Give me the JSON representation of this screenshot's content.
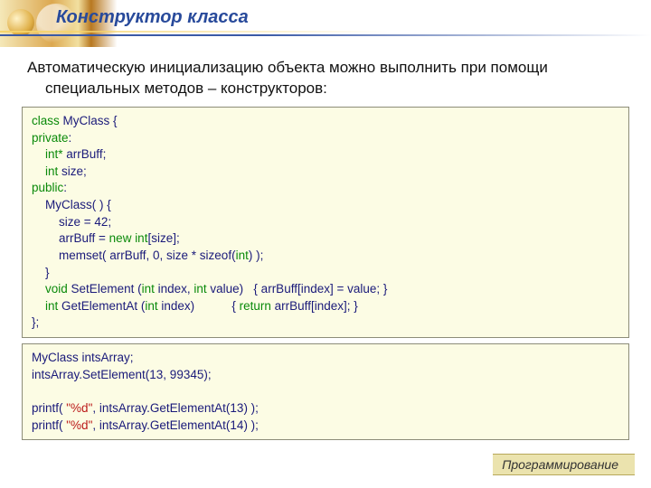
{
  "title": "Конструктор класса",
  "paragraph": "Автоматическую инициализацию объекта можно выполнить при помощи специальных методов – конструкторов:",
  "footer": "Программирование",
  "code1_lines": [
    [
      [
        "g",
        "class "
      ],
      [
        "b",
        "MyClass {"
      ]
    ],
    [
      [
        "g",
        "private"
      ],
      [
        "b",
        ":"
      ]
    ],
    [
      [
        "b",
        "    "
      ],
      [
        "g",
        "int"
      ],
      [
        "gs",
        "* "
      ],
      [
        "b",
        "arrBuff;"
      ]
    ],
    [
      [
        "b",
        "    "
      ],
      [
        "g",
        "int "
      ],
      [
        "b",
        "size;"
      ]
    ],
    [
      [
        "g",
        "public"
      ],
      [
        "b",
        ":"
      ]
    ],
    [
      [
        "b",
        "    MyClass( ) {"
      ]
    ],
    [
      [
        "b",
        "        size = 42;"
      ]
    ],
    [
      [
        "b",
        "        arrBuff = "
      ],
      [
        "g",
        "new int"
      ],
      [
        "b",
        "[size];"
      ]
    ],
    [
      [
        "b",
        "        memset( arrBuff, 0, size * sizeof("
      ],
      [
        "g",
        "int"
      ],
      [
        "b",
        ") );"
      ]
    ],
    [
      [
        "b",
        "    }"
      ]
    ],
    [
      [
        "b",
        "    "
      ],
      [
        "g",
        "void "
      ],
      [
        "b",
        "SetElement ("
      ],
      [
        "g",
        "int "
      ],
      [
        "b",
        "index, "
      ],
      [
        "g",
        "int "
      ],
      [
        "b",
        "value)   { arrBuff[index] = value; }"
      ]
    ],
    [
      [
        "b",
        "    "
      ],
      [
        "g",
        "int "
      ],
      [
        "b",
        "GetElementAt ("
      ],
      [
        "g",
        "int "
      ],
      [
        "b",
        "index)           { "
      ],
      [
        "g",
        "return "
      ],
      [
        "b",
        "arrBuff[index]; }"
      ]
    ],
    [
      [
        "b",
        "};"
      ]
    ]
  ],
  "code2_lines": [
    [
      [
        "b",
        "MyClass intsArray;"
      ]
    ],
    [
      [
        "b",
        "intsArray.SetElement(13, 99345);"
      ]
    ],
    [
      [
        "b",
        ""
      ]
    ],
    [
      [
        "b",
        "printf( "
      ],
      [
        "r",
        "\"%d\""
      ],
      [
        "b",
        ", intsArray.GetElementAt(13) );"
      ]
    ],
    [
      [
        "b",
        "printf( "
      ],
      [
        "r",
        "\"%d\""
      ],
      [
        "b",
        ", intsArray.GetElementAt(14) );"
      ]
    ]
  ]
}
